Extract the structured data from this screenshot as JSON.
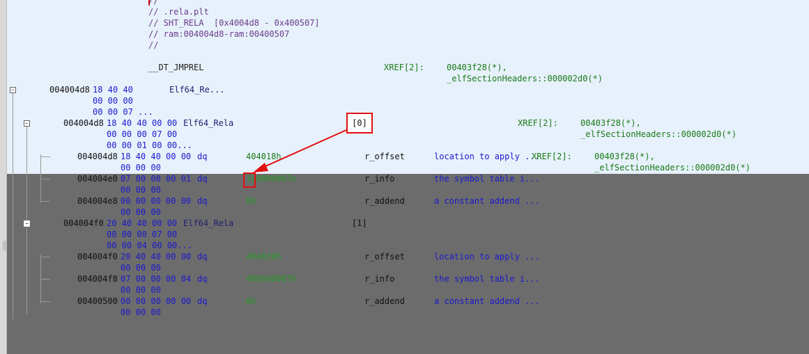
{
  "header_comment": {
    "l0": "//",
    "l1": "// .rela.plt",
    "l2": "// SHT_RELA  [0x4004d8 - 0x400507]",
    "l3": "// ram:004004d8-ram:00400507",
    "l4": "//"
  },
  "label": {
    "name": "__DT_JMPREL",
    "xref": "XREF[2]:",
    "xref1": "00403f28(*),",
    "xref2": "_elfSectionHeaders::000002d0(*)"
  },
  "top_struct": {
    "addr": "004004d8",
    "b1": "18 40 40",
    "b2": "00 00 00",
    "b3": "00 00 07 ...",
    "type": "Elf64_Re..."
  },
  "rela0": {
    "addr": "004004d8",
    "b1": "18 40 40 00 00",
    "b2": "00 00 00 07 00",
    "b3": "00 00 01 00 00...",
    "type": "Elf64_Rela",
    "index": "[0]",
    "xref": "XREF[2]:",
    "xref1": "00403f28(*),",
    "xref2": "_elfSectionHeaders::000002d0(*)"
  },
  "rela0_offset": {
    "addr": "004004d8",
    "b1": "18 40 40 00 00",
    "b2": "00 00 00",
    "mn": "dq",
    "val": "404018h",
    "field": "r_offset",
    "desc": "location to apply ...",
    "xref": "XREF[2]:",
    "xref1": "00403f28(*),",
    "xref2": "_elfSectionHeaders::000002d0(*)"
  },
  "rela0_info": {
    "addr": "004004e0",
    "b1": "07 00 00 00 01",
    "b2": "00 00 00",
    "mn": "dq",
    "val": "100000007h",
    "field": "r_info",
    "desc": "the symbol table i..."
  },
  "rela0_addend": {
    "addr": "004004e8",
    "b1": "00 00 00 00 00",
    "b2": "00 00 00",
    "mn": "dq",
    "val": "0h",
    "field": "r_addend",
    "desc": "a constant addend ..."
  },
  "rela1": {
    "addr": "004004f0",
    "b1": "20 40 40 00 00",
    "b2": "00 00 00 07 00",
    "b3": "00 00 04 00 00...",
    "type": "Elf64_Rela",
    "index": "[1]"
  },
  "rela1_offset": {
    "addr": "004004f0",
    "b1": "20 40 40 00 00",
    "b2": "00 00 00",
    "mn": "dq",
    "val": "404020h",
    "field": "r_offset",
    "desc": "location to apply ..."
  },
  "rela1_info": {
    "addr": "004004f8",
    "b1": "07 00 00 00 04",
    "b2": "00 00 00",
    "mn": "dq",
    "val": "400000007h",
    "field": "r_info",
    "desc": "the symbol table i..."
  },
  "rela1_addend": {
    "addr": "00400500",
    "b1": "00 00 00 00 00",
    "b2": "00 00 00",
    "mn": "dq",
    "val": "0h",
    "field": "r_addend",
    "desc": "a constant addend ..."
  },
  "tree_toggle": {
    "expanded": "−"
  },
  "colors": {
    "selection_bg": "#e7f1fb",
    "unselected_bg": "#6c6c6c",
    "annotation_red": "#e01010"
  },
  "icons": {
    "tree_toggle": "minus-box-icon",
    "callout_arrow": "arrow-icon"
  }
}
